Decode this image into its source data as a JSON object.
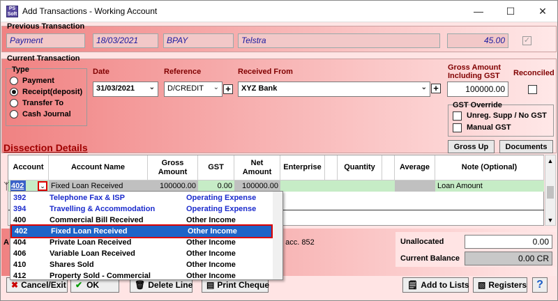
{
  "window": {
    "app_icon": "PS\nSoft",
    "title": "Add Transactions - Working Account"
  },
  "previous": {
    "label": "Previous Transaction",
    "type": "Payment",
    "date": "18/03/2021",
    "reference": "BPAY",
    "party": "Telstra",
    "amount": "45.00"
  },
  "current": {
    "label": "Current Transaction",
    "type_label": "Type",
    "types": [
      "Payment",
      "Receipt(deposit)",
      "Transfer To",
      "Cash Journal"
    ],
    "date_label": "Date",
    "date": "31/03/2021",
    "reference_label": "Reference",
    "reference": "D/CREDIT",
    "received_from_label": "Received From",
    "received_from": "XYZ Bank",
    "gross_label_1": "Gross Amount",
    "gross_label_2": "Including GST",
    "gross": "100000.00",
    "reconciled_label": "Reconciled",
    "gst_override_label": "GST Override",
    "unreg_label": "Unreg. Supp / No GST",
    "manual_label": "Manual GST",
    "gross_up": "Gross Up",
    "documents": "Documents"
  },
  "dissection": {
    "label": "Dissection Details",
    "headers": [
      "Account",
      "Account Name",
      "Gross\nAmount",
      "GST",
      "Net\nAmount",
      "Enterprise",
      "Quantity",
      "Average",
      "Note (Optional)"
    ],
    "row": {
      "account": "402",
      "name": "Fixed Loan Received",
      "gross": "100000.00",
      "gst": "0.00",
      "net": "100000.00",
      "note": "Loan Amount"
    }
  },
  "dropdown": [
    {
      "code": "392",
      "name": "Telephone Fax & ISP",
      "type": "Operating Expense"
    },
    {
      "code": "394",
      "name": "Travelling & Accommodation",
      "type": "Operating Expense"
    },
    {
      "code": "400",
      "name": "Commercial Bill Received",
      "type": "Other Income"
    },
    {
      "code": "402",
      "name": "Fixed Loan Received",
      "type": "Other Income"
    },
    {
      "code": "404",
      "name": "Private Loan Received",
      "type": "Other Income"
    },
    {
      "code": "406",
      "name": "Variable Loan Received",
      "type": "Other Income"
    },
    {
      "code": "410",
      "name": "Shares Sold",
      "type": "Other Income"
    },
    {
      "code": "412",
      "name": "Property Sold - Commercial",
      "type": "Other Income"
    }
  ],
  "bottom": {
    "hint_prefix": "A",
    "hint_suffix": "o acc. 852",
    "unallocated_label": "Unallocated",
    "unallocated": "0.00",
    "balance_label": "Current Balance",
    "balance": "0.00 CR",
    "cancel": "Cancel/Exit",
    "ok": "OK",
    "delete": "Delete Line",
    "print": "Print Cheque",
    "add_lists": "Add to Lists",
    "registers": "Registers",
    "help": "?"
  }
}
